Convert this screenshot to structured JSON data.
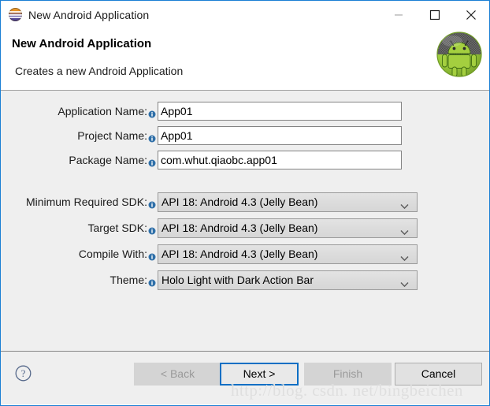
{
  "window": {
    "title": "New Android Application",
    "app_icon": "eclipse-icon",
    "controls": {
      "minimize": "minimize-icon",
      "maximize": "maximize-icon",
      "close": "close-icon"
    }
  },
  "header": {
    "title": "New Android Application",
    "subtitle": "Creates a new Android Application",
    "logo": "android-robot-icon"
  },
  "form": {
    "text_fields": [
      {
        "label": "Application Name:",
        "value": "App01",
        "placeholder": "",
        "info": "info-icon"
      },
      {
        "label": "Project Name:",
        "value": "App01",
        "placeholder": "",
        "info": "info-icon"
      },
      {
        "label": "Package Name:",
        "value": "com.whut.qiaobc.app01",
        "placeholder": "",
        "info": "info-icon"
      }
    ],
    "combo_fields": [
      {
        "label": "Minimum Required SDK:",
        "value": "API 18: Android 4.3 (Jelly Bean)",
        "info": "info-icon"
      },
      {
        "label": "Target SDK:",
        "value": "API 18: Android 4.3 (Jelly Bean)",
        "info": "info-icon"
      },
      {
        "label": "Compile With:",
        "value": "API 18: Android 4.3 (Jelly Bean)",
        "info": "info-icon"
      },
      {
        "label": "Theme:",
        "value": "Holo Light with Dark Action Bar",
        "info": "info-icon"
      }
    ]
  },
  "footer": {
    "help": "help-icon",
    "buttons": [
      {
        "label": "< Back",
        "state": "disabled"
      },
      {
        "label": "Next >",
        "state": "default"
      },
      {
        "label": "Finish",
        "state": "disabled"
      },
      {
        "label": "Cancel",
        "state": "normal"
      }
    ]
  },
  "watermark": {
    "text": "http://blog. csdn. net/bingbeichen"
  },
  "colors": {
    "accent": "#0d6fc4",
    "window_border": "#1a7fd4",
    "panel_bg": "#efefef",
    "info_blue": "#2f6fa8"
  }
}
